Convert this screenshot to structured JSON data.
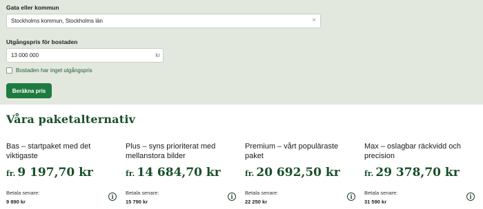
{
  "form": {
    "address_label": "Gata eller kommun",
    "address_value": "Stockholms kommun, Stockholms län",
    "clear_symbol": "×",
    "price_label": "Utgångspris för bostaden",
    "price_value": "13 000 000",
    "price_unit": "kr",
    "no_price_label": "Bostaden har inget utgångspris",
    "no_price_checked": false,
    "submit_label": "Beräkna pris"
  },
  "packages": {
    "title": "Våra paketalternativ",
    "price_prefix": "fr.",
    "pay_later_label": "Betala senare:",
    "info_symbol": "i",
    "items": [
      {
        "title": "Bas – startpaket med det viktigaste",
        "price": "9 197,70 kr",
        "pay_later": "9 890 kr"
      },
      {
        "title": "Plus – syns prioriterat med mellanstora bilder",
        "price": "14 684,70 kr",
        "pay_later": "15 790 kr"
      },
      {
        "title": "Premium – vårt populäraste paket",
        "price": "20 692,50 kr",
        "pay_later": "22 250 kr"
      },
      {
        "title": "Max – oslagbar räckvidd och precision",
        "price": "29 378,70 kr",
        "pay_later": "31 590 kr"
      }
    ]
  },
  "colors": {
    "form_background": "#e3e8de",
    "accent_green": "#1e7b3f",
    "heading_green": "#184f2a"
  }
}
